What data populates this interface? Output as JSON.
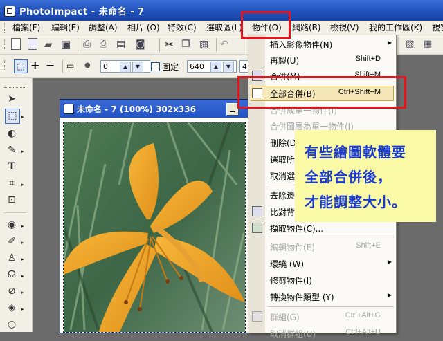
{
  "window": {
    "title": "PhotoImpact - 未命名 - 7"
  },
  "menubar": {
    "items": [
      "檔案(F)",
      "編輯(E)",
      "調整(A)",
      "相片 (O)",
      "特效(C)",
      "選取區(L)",
      "物件(O)",
      "網路(B)",
      "檢視(V)",
      "我的工作區(K)",
      "視窗"
    ]
  },
  "toolbar2": {
    "value1": "0",
    "fixed_label": "固定",
    "width_value": "640",
    "height_value": "4"
  },
  "image_window": {
    "title": "未命名 - 7 (100%) 302x336"
  },
  "dropdown": {
    "items": [
      {
        "label": "插入影像物件(N)",
        "shortcut": "",
        "submenu": true,
        "disabled": false
      },
      {
        "label": "再製(U)",
        "shortcut": "Shift+D",
        "submenu": false,
        "disabled": false
      },
      {
        "label": "合併(M)",
        "shortcut": "Shift+M",
        "submenu": false,
        "disabled": false
      },
      {
        "label": "全部合併(B)",
        "shortcut": "Ctrl+Shift+M",
        "submenu": false,
        "disabled": false
      },
      {
        "label": "合併成單一物件(I)",
        "shortcut": "",
        "submenu": false,
        "disabled": true
      },
      {
        "label": "合併圖層為單一物件(J)",
        "shortcut": "",
        "submenu": false,
        "disabled": true
      },
      {
        "label": "刪除(D)",
        "shortcut": "",
        "submenu": false,
        "disabled": false
      },
      {
        "label": "選取所",
        "shortcut": "",
        "submenu": false,
        "disabled": false
      },
      {
        "label": "取消選",
        "shortcut": "",
        "submenu": false,
        "disabled": false
      },
      {
        "label": "去除邊",
        "shortcut": "",
        "submenu": false,
        "disabled": false
      },
      {
        "label": "比對背",
        "shortcut": "",
        "submenu": false,
        "disabled": false
      },
      {
        "label": "擷取物件(C)...",
        "shortcut": "",
        "submenu": false,
        "disabled": false
      },
      {
        "label": "編輯物件(E)",
        "shortcut": "Shift+E",
        "submenu": false,
        "disabled": true
      },
      {
        "label": "環繞 (W)",
        "shortcut": "",
        "submenu": true,
        "disabled": false
      },
      {
        "label": "修剪物件(I)",
        "shortcut": "",
        "submenu": false,
        "disabled": false
      },
      {
        "label": "轉換物件類型 (Y)",
        "shortcut": "",
        "submenu": true,
        "disabled": false
      },
      {
        "label": "群組(G)",
        "shortcut": "Ctrl+Alt+G",
        "submenu": false,
        "disabled": true
      },
      {
        "label": "取消群組(U)",
        "shortcut": "Ctrl+Alt+U",
        "submenu": false,
        "disabled": true
      }
    ]
  },
  "note": {
    "lines": [
      "有些繪圖軟體要",
      "全部合併後，",
      "才能調整大小。"
    ]
  },
  "colors": {
    "accent": "#e3141c",
    "note_bg": "#fafaa6",
    "note_text": "#1a3ad0",
    "title_bar": "#2454c4"
  }
}
